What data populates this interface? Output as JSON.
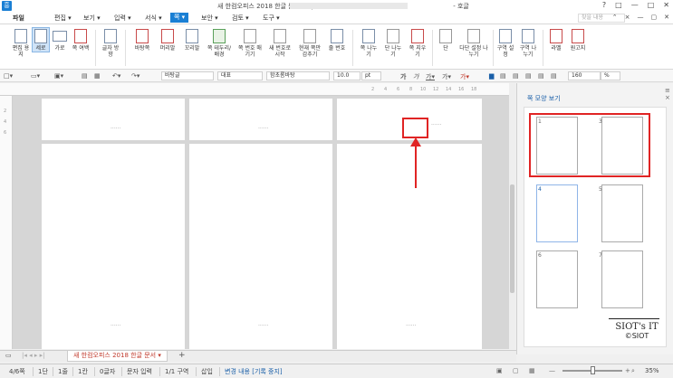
{
  "window": {
    "title": "새 한컴오피스 2018 한글 문서.hwp",
    "app_suffix": "- 호글",
    "controls": [
      "?",
      "□",
      "—",
      "□",
      "✕"
    ]
  },
  "menu": {
    "items": [
      "파일",
      "편집",
      "보기",
      "입력",
      "서식",
      "쪽",
      "보안",
      "검토",
      "도구"
    ],
    "active": "쪽",
    "help_placeholder": "찾을 내용",
    "right_controls": [
      "⌃",
      "×",
      "—",
      "▢",
      "✕"
    ]
  },
  "ribbon": {
    "buttons": [
      {
        "label": "편집 용지",
        "icon": "page-setup-icon"
      },
      {
        "label": "세로",
        "icon": "portrait-icon",
        "selected": true
      },
      {
        "label": "가로",
        "icon": "landscape-icon"
      },
      {
        "label": "쪽 여백",
        "icon": "margin-icon"
      },
      {
        "label": "글자 방향",
        "icon": "text-direction-icon"
      },
      {
        "label": "바탕쪽",
        "icon": "master-page-icon"
      },
      {
        "label": "머리말",
        "icon": "header-icon"
      },
      {
        "label": "꼬리말",
        "icon": "footer-icon"
      },
      {
        "label": "쪽 테두리/ 배경",
        "icon": "page-border-icon"
      },
      {
        "label": "쪽 번호 매기기",
        "icon": "page-number-icon"
      },
      {
        "label": "새 번호로 시작",
        "icon": "new-number-icon"
      },
      {
        "label": "현재 쪽만 감추기",
        "icon": "hide-icon"
      },
      {
        "label": "줄 번호",
        "icon": "line-number-icon"
      },
      {
        "label": "쪽 나누기",
        "icon": "page-break-icon"
      },
      {
        "label": "단 나누기",
        "icon": "column-break-icon"
      },
      {
        "label": "쪽 지우기",
        "icon": "delete-page-icon"
      },
      {
        "label": "단",
        "icon": "columns-icon"
      },
      {
        "label": "다단 설정 나누기",
        "icon": "multi-column-icon"
      },
      {
        "label": "구역 설정",
        "icon": "section-setup-icon"
      },
      {
        "label": "구역 나누기",
        "icon": "section-break-icon"
      },
      {
        "label": "라벨",
        "icon": "label-icon"
      },
      {
        "label": "원고지",
        "icon": "manuscript-icon"
      }
    ]
  },
  "format_bar": {
    "style": "바탕글",
    "language": "대표",
    "font": "함초롬바탕",
    "size": "10.0",
    "unit": "pt",
    "zoom": "160",
    "zoom_unit": "%"
  },
  "ruler": {
    "ticks": [
      "2",
      "4",
      "6",
      "8",
      "10",
      "12",
      "14",
      "16",
      "18"
    ],
    "vticks": [
      "2",
      "4",
      "6"
    ]
  },
  "pages": {
    "dots": "......"
  },
  "side_panel": {
    "title": "쪽 모양 보기",
    "thumbnails": [
      "1",
      "3",
      "4",
      "5",
      "6",
      "7"
    ],
    "watermark_line1": "SIOT's IT",
    "watermark_line2": "©SIOT"
  },
  "tabs": {
    "doc_tab": "새 한컴오피스 2018 한글 문서",
    "add": "+"
  },
  "status": {
    "page": "4/6쪽",
    "column": "1단",
    "line": "1줄",
    "col_pos": "1칸",
    "chars": "0글자",
    "mode": "문자 입력",
    "section": "1/1 구역",
    "insert": "삽입",
    "track": "변경 내용 [기록 중지]",
    "zoom": "35%"
  },
  "colors": {
    "accent": "#1a7fd4",
    "highlight": "#e02424"
  }
}
